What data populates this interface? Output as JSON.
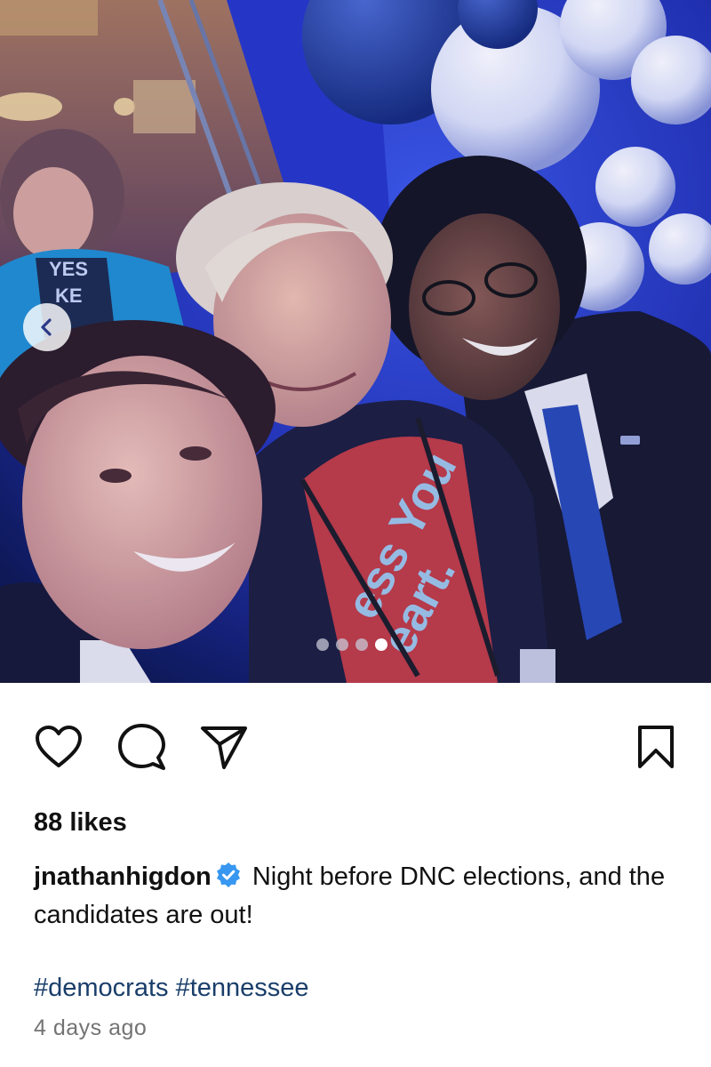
{
  "post": {
    "photo": {
      "description_icon": "group-selfie-photo",
      "shirt_text": "ess You\neart.",
      "sign_text": "YES\nKE",
      "carousel": {
        "total_slides": 4,
        "current_slide": 4,
        "prev_icon": "chevron-left-icon"
      }
    },
    "actions": {
      "like_icon": "heart-icon",
      "comment_icon": "comment-bubble-icon",
      "share_icon": "paper-plane-icon",
      "save_icon": "bookmark-icon"
    },
    "likes_text": "88 likes",
    "caption": {
      "username": "jnathanhigdon",
      "verified": true,
      "verified_icon": "verified-badge-icon",
      "text": "Night before DNC elections, and the candidates are out!"
    },
    "hashtags": [
      "#democrats",
      "#tennessee"
    ],
    "timestamp": "4 days ago"
  },
  "colors": {
    "hashtag": "#1a3e6a",
    "verified_badge": "#3897f0",
    "timestamp": "#737373",
    "dot_active": "#ffffff"
  }
}
